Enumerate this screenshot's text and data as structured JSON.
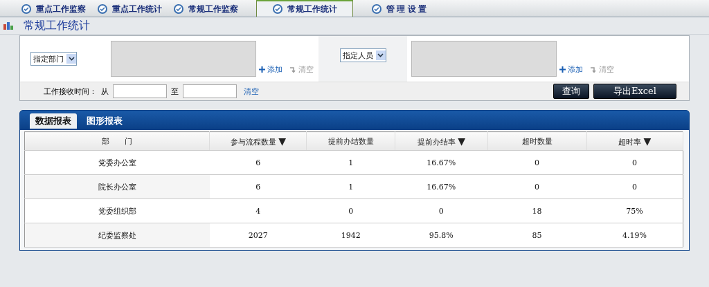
{
  "nav_tabs": [
    {
      "label": "重点工作监察",
      "selected": false
    },
    {
      "label": "重点工作统计",
      "selected": false
    },
    {
      "label": "常规工作监察",
      "selected": false
    },
    {
      "label": "常规工作统计",
      "selected": true
    },
    {
      "label": "管 理 设 置",
      "selected": false
    }
  ],
  "page_title": "常规工作统计",
  "filters": {
    "groups": [
      {
        "select": "指定部门",
        "add": "添加",
        "clear": "清空"
      },
      {
        "select": "指定人员",
        "add": "添加",
        "clear": "清空"
      }
    ],
    "date_label": "工作接收时间：",
    "from": "从",
    "to": "至",
    "date_clear": "清空",
    "buttons": [
      "查询",
      "导出Excel"
    ]
  },
  "report_tabs": [
    {
      "label": "数据报表",
      "selected": true
    },
    {
      "label": "图形报表",
      "selected": false
    }
  ],
  "table": {
    "columns": [
      {
        "label": "部　　门"
      },
      {
        "label": "参与流程数量",
        "arrow": "▼"
      },
      {
        "label": "提前办结数量"
      },
      {
        "label": "提前办结率",
        "arrow": "▼"
      },
      {
        "label": "超时数量"
      },
      {
        "label": "超时率",
        "arrow": "▼"
      }
    ],
    "rows": [
      [
        "党委办公室",
        "6",
        "1",
        "16.67%",
        "0",
        "0"
      ],
      [
        "院长办公室",
        "6",
        "1",
        "16.67%",
        "0",
        "0"
      ],
      [
        "党委组织部",
        "4",
        "0",
        "0",
        "18",
        "75%"
      ],
      [
        "纪委监察处",
        "2027",
        "1942",
        "95.8%",
        "85",
        "4.19%"
      ]
    ]
  }
}
